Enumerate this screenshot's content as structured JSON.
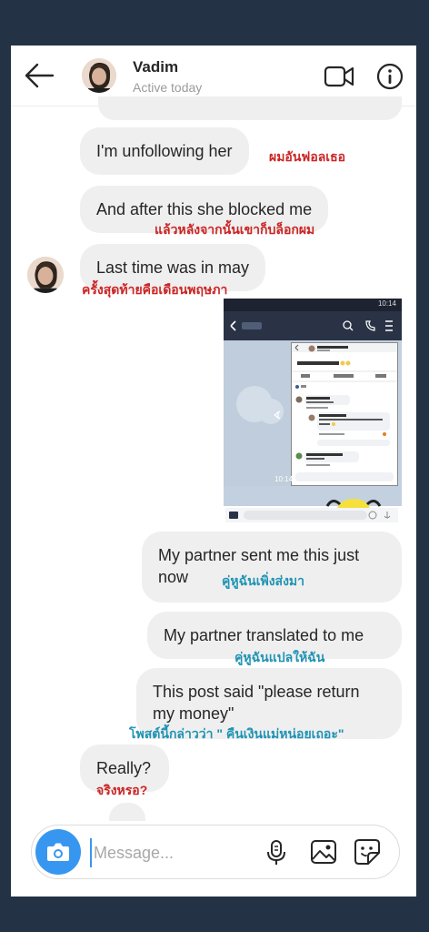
{
  "header": {
    "name": "Vadim",
    "status": "Active today"
  },
  "messages": {
    "m1": {
      "text": "I'm unfollowing her",
      "note": "ผมอันฟอลเธอ"
    },
    "m2": {
      "text": "And after this she blocked me",
      "note": "แล้วหลังจากนั้นเขาก็บล็อกผม"
    },
    "m3": {
      "text": "Last time was in may",
      "note": "ครั้งสุดท้ายคือเดือนพฤษภา"
    },
    "m4": {
      "text_line1": "My partner sent me this just",
      "text_line2": "now",
      "note": "คู่หูฉันเพิ่งส่งมา"
    },
    "m5": {
      "text": "My partner translated to me",
      "note": "คู่หูฉันแปลให้ฉัน"
    },
    "m6": {
      "text_line1": "This post said \"please return",
      "text_line2": "my money\"",
      "note": "โพสต์นี้กล่าวว่า \" คืนเงินแม่หน่อยเถอะ\""
    },
    "m7": {
      "text": "Really?",
      "note": "จริงหรอ?"
    }
  },
  "screenshot": {
    "status_time": "10:14",
    "post_author": "Sarah Cunnington",
    "post_text": "คืนเงินแม่หน่อยเถอะ 😔🙏",
    "like": "Like",
    "comment": "Comment",
    "send": "Send",
    "commenter1": "Ukuat Samritsari",
    "commenter2": "Sarah Cunnington",
    "commenter3": "Prasartu Thitiporn Sai",
    "time": "10:14"
  },
  "composer": {
    "placeholder": "Message..."
  },
  "colors": {
    "background": "#243246",
    "bubble": "#efefef",
    "note_red": "#cc2424",
    "note_teal": "#1f93b4",
    "accent": "#3797f0"
  },
  "icons": {
    "back": "arrow-left-icon",
    "video": "video-camera-icon",
    "info": "info-icon",
    "camera": "camera-icon",
    "mic": "microphone-icon",
    "gallery": "image-icon",
    "sticker": "sticker-icon"
  }
}
